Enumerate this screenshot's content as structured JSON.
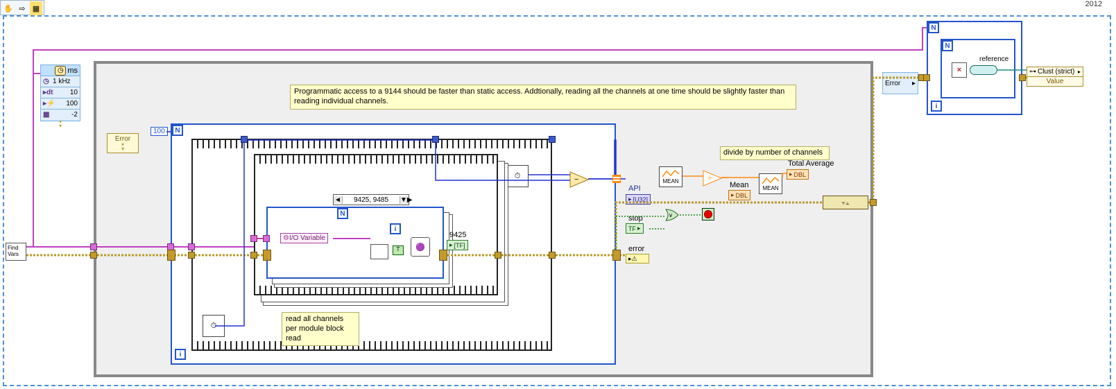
{
  "toolbar": {
    "tool1": "pan",
    "tool2": "arrow",
    "tool3": "highlight"
  },
  "year_label": "2012",
  "timed_loop": {
    "unit": "ms",
    "rows": {
      "rate": "1 kHz",
      "dt": "10",
      "priority": "100",
      "offset": "-2"
    }
  },
  "error_cluster_left": "Error",
  "comment_main": "Programmatic access to a 9144 should be faster than static access. Addtionally, reading all the channels at one time should be slightly faster than reading individual channels.",
  "find_vars_label": "Find\nVars",
  "for_loop_outer": {
    "N": "N",
    "i": "i",
    "count_const": "100"
  },
  "for_loop_inner": {
    "N": "N",
    "i": "i"
  },
  "stacked_seq": {
    "selector_left": "◄",
    "selector_text": "9425, 9485",
    "selector_right": "▼▶",
    "io_variable": "I/O Variable",
    "indicator_9425": "9425",
    "indicator_9425_type": "[TF]"
  },
  "comment_read": "read all channels\nper module block\nread",
  "api_label": "API",
  "api_type": "[U32]",
  "stop_label": "stop",
  "stop_type": "TF",
  "error_label": "error",
  "divide_comment": "divide by number of channels",
  "mean1": "MEAN",
  "mean2": "MEAN",
  "mean_label": "Mean",
  "total_avg_label": "Total Average",
  "dbl1": "DBL",
  "dbl2": "DBL",
  "right_error": "Error",
  "right_for": {
    "N": "N",
    "i": "i"
  },
  "reference_label": "reference",
  "prop_node": {
    "header": "Clust (strict)",
    "item": "Value"
  }
}
